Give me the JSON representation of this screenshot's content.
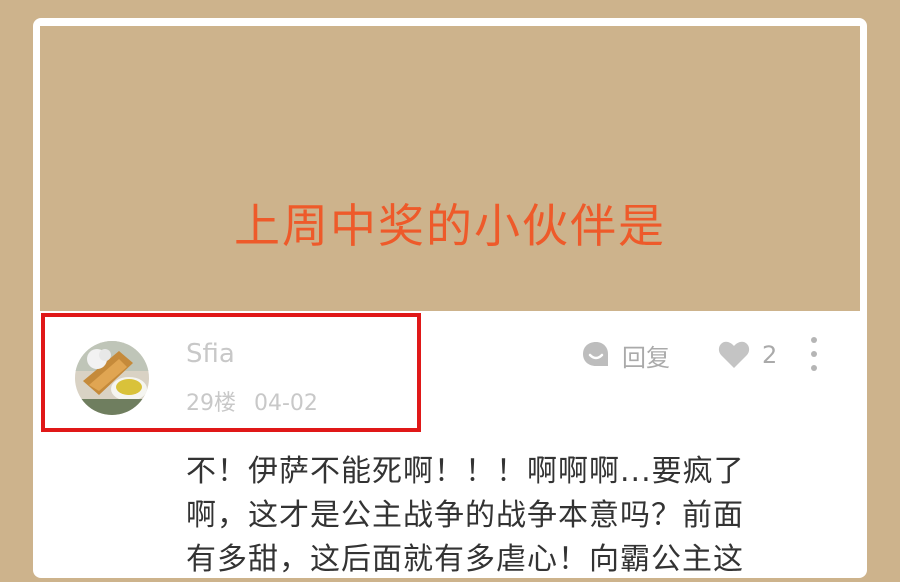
{
  "banner": {
    "title": "上周中奖的小伙伴是"
  },
  "comment": {
    "username": "Sfia",
    "floor": "29楼",
    "date": "04-02",
    "reply_label": "回复",
    "like_count": "2",
    "text_lines": [
      "不！伊萨不能死啊！！！啊啊啊...要疯了",
      "啊，这才是公主战争的战争本意吗？前面",
      "有多甜，这后面就有多虐心！向霸公主这"
    ]
  },
  "colors": {
    "background": "#cdb38c",
    "banner_title": "#ee5a2a",
    "highlight": "#e01818",
    "meta_text": "#c8c8c8"
  }
}
